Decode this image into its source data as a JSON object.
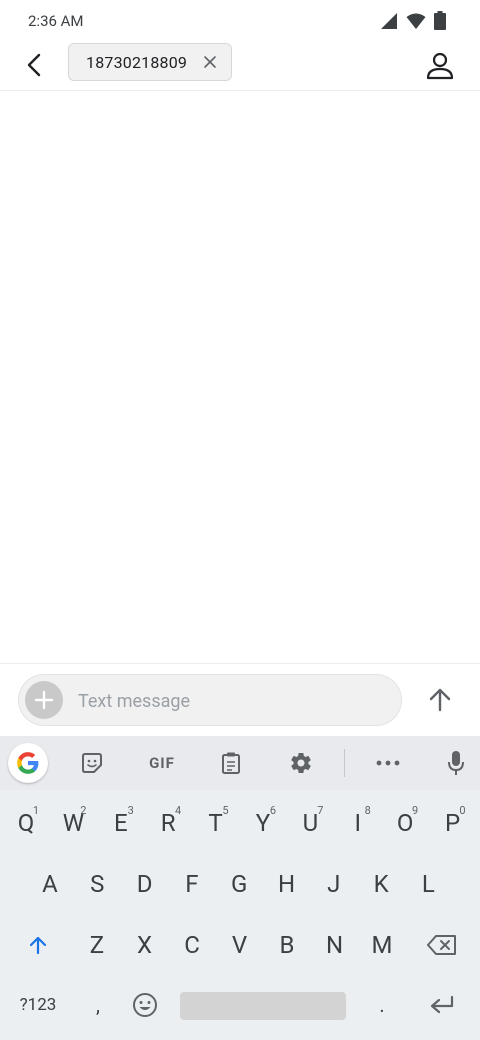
{
  "status_bar": {
    "time": "2:36 AM"
  },
  "app_bar": {
    "recipient": "18730218809"
  },
  "compose": {
    "placeholder": "Text message"
  },
  "keyboard": {
    "toolbar": {
      "gif_label": "GIF"
    },
    "row1": [
      {
        "label": "Q",
        "hint": "1"
      },
      {
        "label": "W",
        "hint": "2"
      },
      {
        "label": "E",
        "hint": "3"
      },
      {
        "label": "R",
        "hint": "4"
      },
      {
        "label": "T",
        "hint": "5"
      },
      {
        "label": "Y",
        "hint": "6"
      },
      {
        "label": "U",
        "hint": "7"
      },
      {
        "label": "I",
        "hint": "8"
      },
      {
        "label": "O",
        "hint": "9"
      },
      {
        "label": "P",
        "hint": "0"
      }
    ],
    "row2": [
      "A",
      "S",
      "D",
      "F",
      "G",
      "H",
      "J",
      "K",
      "L"
    ],
    "row3": [
      "Z",
      "X",
      "C",
      "V",
      "B",
      "N",
      "M"
    ],
    "symbols_label": "?123",
    "comma_label": ",",
    "period_label": "."
  }
}
